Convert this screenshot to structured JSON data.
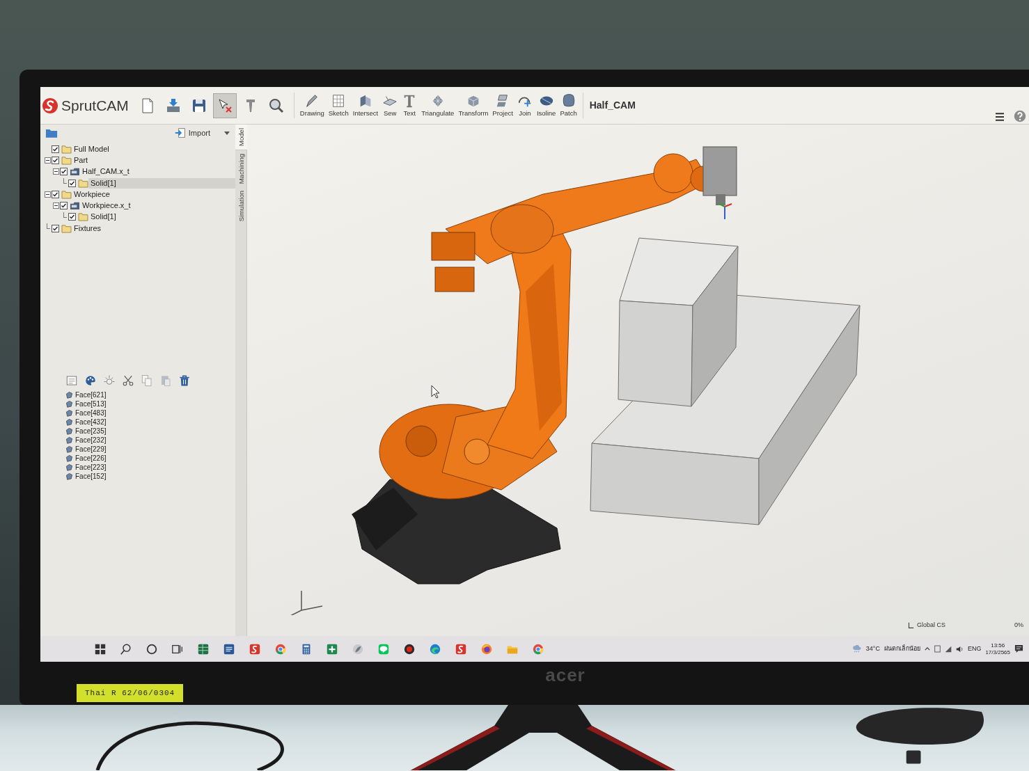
{
  "toolbar": {
    "logo": "SprutCAM",
    "icon_tools": [
      {
        "kind": "new",
        "selected": false
      },
      {
        "kind": "open",
        "selected": false
      },
      {
        "kind": "save",
        "selected": false
      },
      {
        "kind": "select",
        "selected": true
      },
      {
        "kind": "tool",
        "selected": false
      },
      {
        "kind": "zoom",
        "selected": false
      }
    ],
    "tools": [
      {
        "kind": "drawing",
        "label": "Drawing"
      },
      {
        "kind": "sketch",
        "label": "Sketch"
      },
      {
        "kind": "intersect",
        "label": "Intersect"
      },
      {
        "kind": "sew",
        "label": "Sew"
      },
      {
        "kind": "text",
        "label": "Text"
      },
      {
        "kind": "triangulate",
        "label": "Triangulate"
      },
      {
        "kind": "transform",
        "label": "Transform"
      },
      {
        "kind": "project",
        "label": "Project"
      },
      {
        "kind": "join",
        "label": "Join"
      },
      {
        "kind": "isoline",
        "label": "Isoline"
      },
      {
        "kind": "patch",
        "label": "Patch"
      }
    ],
    "project_title": "Half_CAM"
  },
  "model_panel": {
    "import_button": "Import",
    "tree": [
      {
        "kind": "folder",
        "label": "Full Model",
        "checked": true,
        "selected": false
      },
      {
        "kind": "folder",
        "label": "Part",
        "checked": true,
        "selected": false,
        "expanded": true,
        "children": [
          {
            "kind": "file",
            "label": "Half_CAM.x_t",
            "checked": true,
            "selected": false,
            "expanded": true,
            "children": [
              {
                "kind": "folder",
                "label": "Solid[1]",
                "checked": true,
                "selected": true
              }
            ]
          }
        ]
      },
      {
        "kind": "folder",
        "label": "Workpiece",
        "checked": true,
        "selected": false,
        "expanded": true,
        "children": [
          {
            "kind": "file",
            "label": "Workpiece.x_t",
            "checked": true,
            "selected": false,
            "expanded": true,
            "children": [
              {
                "kind": "folder",
                "label": "Solid[1]",
                "checked": true,
                "selected": false
              }
            ]
          }
        ]
      },
      {
        "kind": "folder",
        "label": "Fixtures",
        "checked": true,
        "selected": false
      }
    ],
    "side_tabs": [
      {
        "label": "Model",
        "selected": true
      },
      {
        "label": "Machining",
        "selected": false
      },
      {
        "label": "Simulation",
        "selected": false
      }
    ],
    "faces": [
      "Face[621]",
      "Face[513]",
      "Face[483]",
      "Face[432]",
      "Face[235]",
      "Face[232]",
      "Face[229]",
      "Face[226]",
      "Face[223]",
      "Face[152]"
    ]
  },
  "viewport": {
    "coordinate_system": "Global CS",
    "progress": "0%"
  },
  "taskbar": {
    "buttons": [
      {
        "kind": "start"
      },
      {
        "kind": "search"
      },
      {
        "kind": "cortana"
      },
      {
        "kind": "task_view"
      },
      {
        "kind": "excel"
      },
      {
        "kind": "word"
      },
      {
        "kind": "sprutcam"
      },
      {
        "kind": "chrome"
      },
      {
        "kind": "calculator"
      },
      {
        "kind": "plus"
      },
      {
        "kind": "leaf"
      },
      {
        "kind": "chat"
      },
      {
        "kind": "record"
      },
      {
        "kind": "edge"
      },
      {
        "kind": "sprutcam"
      },
      {
        "kind": "firefox"
      },
      {
        "kind": "folder"
      },
      {
        "kind": "chrome"
      }
    ],
    "weather": {
      "temperature": "34°C",
      "condition": "ฝนตกเล็กน้อย"
    },
    "language": "ENG",
    "time": "13:56",
    "date": "17/3/2565"
  },
  "monitor": {
    "brand": "acer",
    "asset_tag": "Thai R 62/06/0304"
  }
}
